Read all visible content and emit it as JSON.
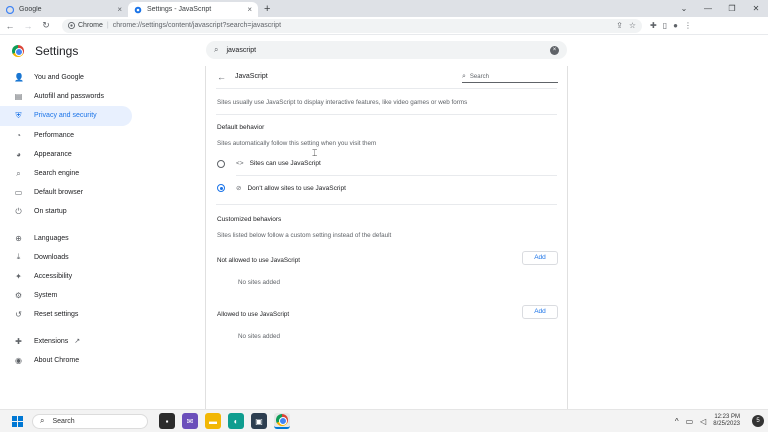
{
  "browser": {
    "tabs": [
      {
        "title": "Google",
        "active": false,
        "close": "×"
      },
      {
        "title": "Settings - JavaScript",
        "active": true,
        "close": "×"
      }
    ],
    "new_tab": "+",
    "window_controls": [
      "⌄",
      "—",
      "❐",
      "✕"
    ],
    "toolbar": {
      "back": "←",
      "forward": "→",
      "reload": "↻",
      "site_label": "Chrome",
      "separator": "|",
      "url": "chrome://settings/content/javascript?search=javascript"
    }
  },
  "settings": {
    "title": "Settings",
    "search_value": "javascript",
    "search_clear": "×",
    "sidebar": {
      "items": [
        {
          "label": "You and Google",
          "icon": "person-icon",
          "glyph": "👤"
        },
        {
          "label": "Autofill and passwords",
          "icon": "clipboard-icon",
          "glyph": "▤"
        },
        {
          "label": "Privacy and security",
          "icon": "shield-icon",
          "glyph": "⛨"
        },
        {
          "label": "Performance",
          "icon": "gauge-icon",
          "glyph": "◔"
        },
        {
          "label": "Appearance",
          "icon": "palette-icon",
          "glyph": "◕"
        },
        {
          "label": "Search engine",
          "icon": "search-icon",
          "glyph": "⌕"
        },
        {
          "label": "Default browser",
          "icon": "browser-icon",
          "glyph": "▭"
        },
        {
          "label": "On startup",
          "icon": "power-icon",
          "glyph": "⏻"
        },
        {
          "label": "Languages",
          "icon": "globe-icon",
          "glyph": "⊕"
        },
        {
          "label": "Downloads",
          "icon": "download-icon",
          "glyph": "⤓"
        },
        {
          "label": "Accessibility",
          "icon": "accessibility-icon",
          "glyph": "✦"
        },
        {
          "label": "System",
          "icon": "wrench-icon",
          "glyph": "⚙"
        },
        {
          "label": "Reset settings",
          "icon": "reset-icon",
          "glyph": "↺"
        },
        {
          "label": "Extensions",
          "icon": "puzzle-icon",
          "glyph": "✚"
        },
        {
          "label": "About Chrome",
          "icon": "chrome-icon",
          "glyph": "◉"
        }
      ],
      "active_index": 2,
      "external_link_glyph": "↗"
    },
    "page": {
      "back_glyph": "←",
      "title": "JavaScript",
      "search_placeholder": "Search",
      "description": "Sites usually use JavaScript to display interactive features, like video games or web forms",
      "default_behavior": {
        "heading": "Default behavior",
        "subtext": "Sites automatically follow this setting when you visit them",
        "options": [
          {
            "label": "Sites can use JavaScript",
            "icon_glyph": "<>",
            "checked": false
          },
          {
            "label": "Don't allow sites to use JavaScript",
            "icon_glyph": "⊘",
            "checked": true
          }
        ]
      },
      "customized": {
        "heading": "Customized behaviors",
        "subtext": "Sites listed below follow a custom setting instead of the default",
        "not_allowed": {
          "label": "Not allowed to use JavaScript",
          "add": "Add",
          "empty": "No sites added"
        },
        "allowed": {
          "label": "Allowed to use JavaScript",
          "add": "Add",
          "empty": "No sites added"
        }
      }
    }
  },
  "taskbar": {
    "search_placeholder": "Search",
    "time": "12:23 PM",
    "date": "8/25/2023",
    "tray_up": "^",
    "notification_count": "5",
    "colors": {
      "windows_blue": "#0078d4",
      "accent": "#1a73e8"
    }
  }
}
